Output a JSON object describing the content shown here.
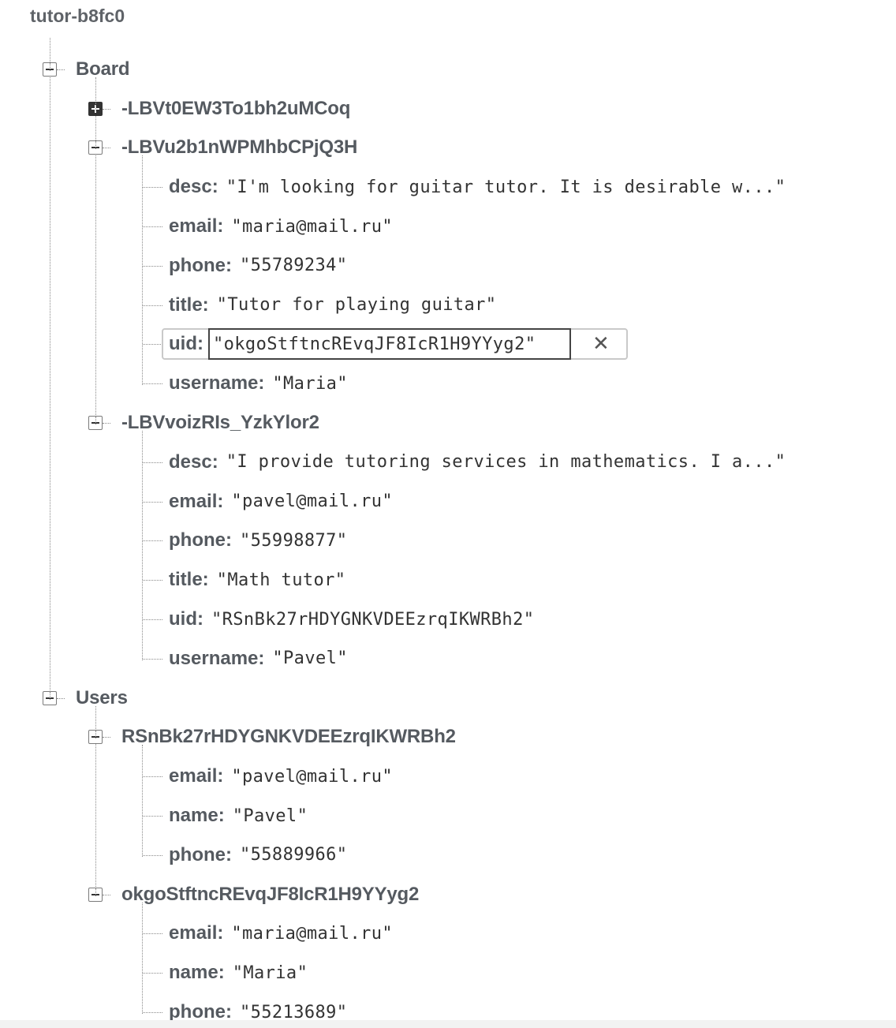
{
  "root": "tutor-b8fc0",
  "board": {
    "label": "Board",
    "entries": [
      {
        "key": "-LBVt0EW3To1bh2uMCoq",
        "collapsed": true,
        "fields": []
      },
      {
        "key": "-LBVu2b1nWPMhbCPjQ3H",
        "collapsed": false,
        "fields": [
          {
            "key": "desc",
            "value": "\"I'm looking for guitar tutor. It is desirable w...\""
          },
          {
            "key": "email",
            "value": "\"maria@mail.ru\""
          },
          {
            "key": "phone",
            "value": "\"55789234\""
          },
          {
            "key": "title",
            "value": "\"Tutor for playing guitar\""
          },
          {
            "key": "uid",
            "value": "\"okgoStftncREvqJF8IcR1H9YYyg2\"",
            "editing": true
          },
          {
            "key": "username",
            "value": "\"Maria\""
          }
        ]
      },
      {
        "key": "-LBVvoizRIs_YzkYlor2",
        "collapsed": false,
        "fields": [
          {
            "key": "desc",
            "value": "\"I provide tutoring services in mathematics. I a...\""
          },
          {
            "key": "email",
            "value": "\"pavel@mail.ru\""
          },
          {
            "key": "phone",
            "value": "\"55998877\""
          },
          {
            "key": "title",
            "value": "\"Math tutor\""
          },
          {
            "key": "uid",
            "value": "\"RSnBk27rHDYGNKVDEEzrqIKWRBh2\""
          },
          {
            "key": "username",
            "value": "\"Pavel\""
          }
        ]
      }
    ]
  },
  "users": {
    "label": "Users",
    "entries": [
      {
        "key": "RSnBk27rHDYGNKVDEEzrqIKWRBh2",
        "collapsed": false,
        "fields": [
          {
            "key": "email",
            "value": "\"pavel@mail.ru\""
          },
          {
            "key": "name",
            "value": "\"Pavel\""
          },
          {
            "key": "phone",
            "value": "\"55889966\""
          }
        ]
      },
      {
        "key": "okgoStftncREvqJF8IcR1H9YYyg2",
        "collapsed": false,
        "fields": [
          {
            "key": "email",
            "value": "\"maria@mail.ru\""
          },
          {
            "key": "name",
            "value": "\"Maria\""
          },
          {
            "key": "phone",
            "value": "\"55213689\""
          }
        ]
      }
    ]
  },
  "icons": {
    "expanded": "collapse-minus-icon",
    "collapsed": "expand-plus-icon",
    "clear": "clear-x-icon"
  },
  "colors": {
    "text": "#555a60",
    "value": "#333333",
    "connector": "#8a8a8a",
    "edit_border": "#444444"
  },
  "clear_symbol": "✕"
}
